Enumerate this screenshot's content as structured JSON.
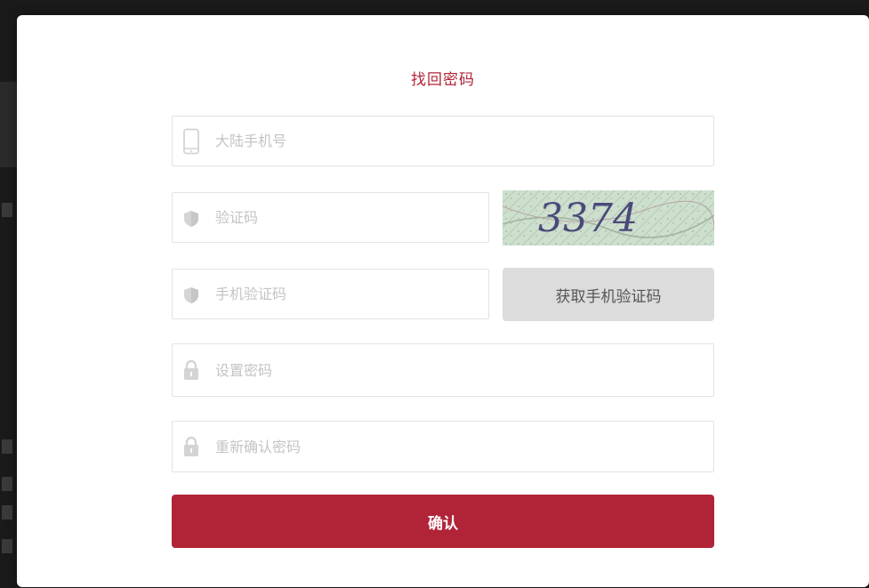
{
  "title": "找回密码",
  "fields": {
    "phone": {
      "placeholder": "大陆手机号",
      "value": ""
    },
    "captcha": {
      "placeholder": "验证码",
      "value": ""
    },
    "sms_code": {
      "placeholder": "手机验证码",
      "value": ""
    },
    "password": {
      "placeholder": "设置密码",
      "value": ""
    },
    "confirm_password": {
      "placeholder": "重新确认密码",
      "value": ""
    }
  },
  "captcha_image": {
    "text": "3374"
  },
  "buttons": {
    "get_sms_code": "获取手机验证码",
    "confirm": "确认"
  },
  "icons": {
    "phone": "phone-icon",
    "captcha_shield": "shield-icon",
    "sms_shield": "shield-icon",
    "password_lock": "lock-icon",
    "confirm_lock": "lock-icon"
  },
  "colors": {
    "accent": "#b12438",
    "icon_gray": "#d4d4d4",
    "sms_button_bg": "#dcdcdc"
  }
}
